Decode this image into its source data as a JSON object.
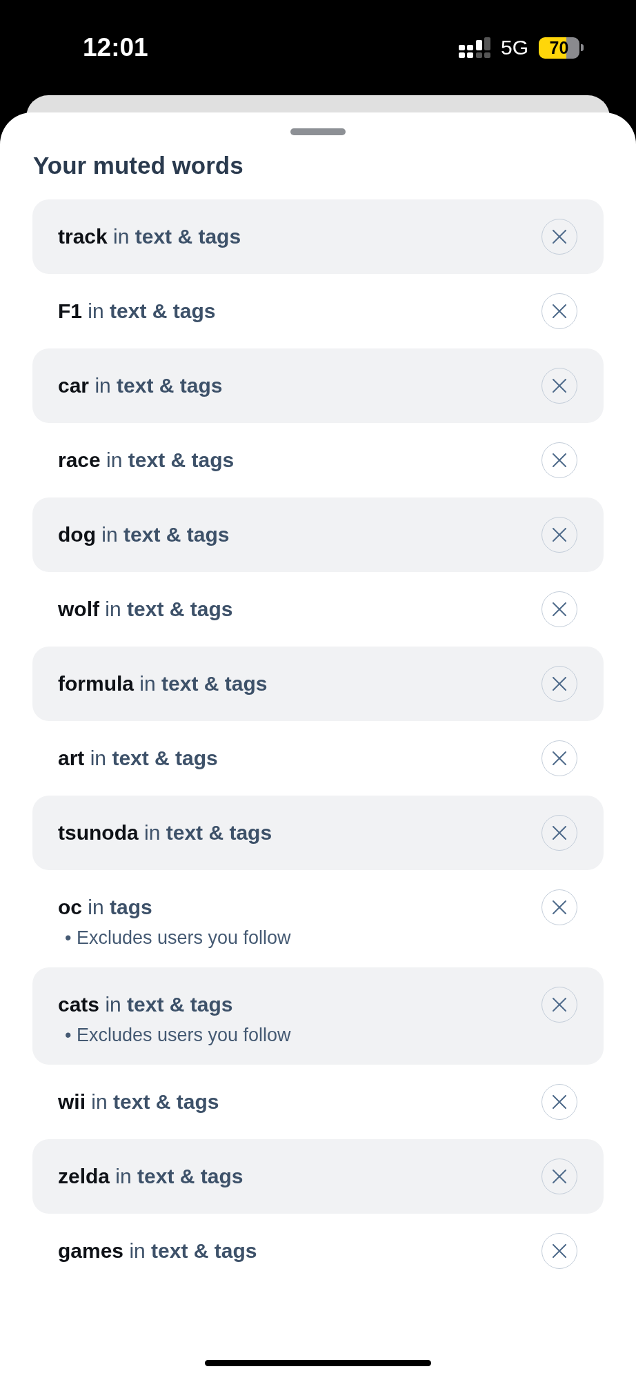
{
  "status_bar": {
    "time": "12:01",
    "network": "5G",
    "battery": "70"
  },
  "sheet": {
    "title": "Your muted words",
    "items": [
      {
        "text": "**track** in **text & tags**"
      },
      {
        "text": "**F1** in **text & tags**"
      },
      {
        "text": "**car** in **text & tags**"
      },
      {
        "text": "**race** in **text & tags**"
      },
      {
        "text": "**dog** in **text & tags**"
      },
      {
        "text": "**wolf** in **text & tags**"
      },
      {
        "text": "**formula** in **text & tags**"
      },
      {
        "text": "**art** in **text & tags**"
      },
      {
        "text": "**tsunoda** in **text & tags**"
      },
      {
        "text": "**oc** in **tags**",
        "note": "• Excludes users you follow"
      },
      {
        "text": "**cats** in **text & tags**",
        "note": "• Excludes users you follow"
      },
      {
        "text": "**wii** in **text & tags**"
      },
      {
        "text": "**zelda** in **text & tags**"
      },
      {
        "text": "**games** in **text & tags**"
      }
    ]
  }
}
